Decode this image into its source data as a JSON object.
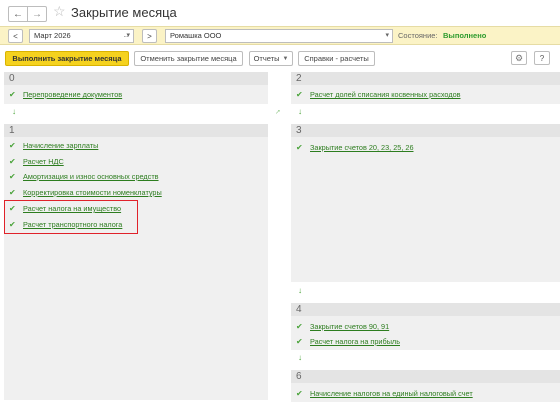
{
  "window": {
    "title": "Закрытие месяца",
    "back_icon": "arrow-left-icon",
    "forward_icon": "arrow-right-icon",
    "favorite_icon": "star-icon"
  },
  "top_panel": {
    "prev_label": "<",
    "period_value": "Март 2026",
    "period_picker_label": "...",
    "next_label": ">",
    "organization_value": "Ромашка ООО",
    "status_label": "Состояние:",
    "status_value": "Выполнено",
    "status_color": "#2e9b2e"
  },
  "toolbar": {
    "run_label": "Выполнить закрытие месяца",
    "cancel_label": "Отменить закрытие месяца",
    "reports_label": "Отчеты",
    "references_label": "Справки - расчеты",
    "settings_icon": "gear-icon",
    "help_label": "?",
    "accent": "#f5d21f"
  },
  "stages": [
    {
      "number": "0",
      "items": [
        "Перепроведение документов"
      ]
    },
    {
      "number": "1",
      "items": [
        "Начисление зарплаты",
        "Расчет НДС",
        "Амортизация и износ основных средств",
        "Корректировка стоимости номенклатуры",
        "Расчет налога на имущество",
        "Расчет транспортного налога"
      ]
    },
    {
      "number": "2",
      "items": [
        "Расчет долей списания косвенных расходов"
      ]
    },
    {
      "number": "3",
      "items": [
        "Закрытие счетов 20, 23, 25, 26"
      ]
    },
    {
      "number": "4",
      "items": [
        "Закрытие счетов 90, 91",
        "Расчет налога на прибыль"
      ]
    },
    {
      "number": "6",
      "items": [
        "Начисление налогов на единый налоговый счет"
      ]
    }
  ],
  "check_icon": "check-icon",
  "highlight_color": "#e0222a"
}
